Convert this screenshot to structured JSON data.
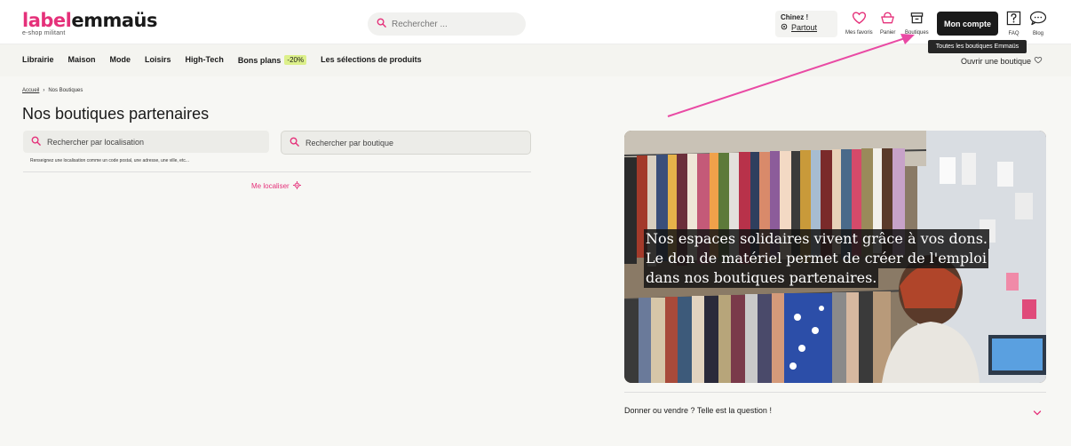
{
  "header": {
    "logo_label": "label",
    "logo_brand": "emmaüs",
    "logo_tagline": "e-shop militant",
    "search_placeholder": "Rechercher ...",
    "chinez_title": "Chinez !",
    "chinez_location": "Partout",
    "icons": [
      {
        "name": "heart-icon",
        "label": "Mes favoris"
      },
      {
        "name": "basket-icon",
        "label": "Panier"
      },
      {
        "name": "shop-icon",
        "label": "Boutiques"
      }
    ],
    "account_label": "Mon compte",
    "faq_label": "FAQ",
    "blog_label": "Blog",
    "tooltip": "Toutes les boutiques Emmaüs",
    "accent_color": "#e5317a"
  },
  "nav": {
    "items": [
      "Librairie",
      "Maison",
      "Mode",
      "Loisirs",
      "High-Tech"
    ],
    "promo_label": "Bons plans",
    "promo_badge": "-20%",
    "selections_label": "Les sélections de produits",
    "open_shop": "Ouvrir une boutique"
  },
  "breadcrumb": {
    "home": "Accueil",
    "separator": "›",
    "current": "Nos Boutiques"
  },
  "main": {
    "title": "Nos boutiques partenaires",
    "search_location_placeholder": "Rechercher par localisation",
    "search_shop_placeholder": "Rechercher par boutique",
    "hint": "Renseignez une localisation comme un code postal, une adresse, une ville, etc...",
    "locate_label": "Me localiser"
  },
  "hero": {
    "lines": [
      "Nos espaces solidaires vivent grâce à vos dons.",
      "Le don de matériel permet de créer de l'emploi",
      "dans nos boutiques partenaires."
    ]
  },
  "faq": {
    "question": "Donner ou vendre ? Telle est la question !"
  }
}
